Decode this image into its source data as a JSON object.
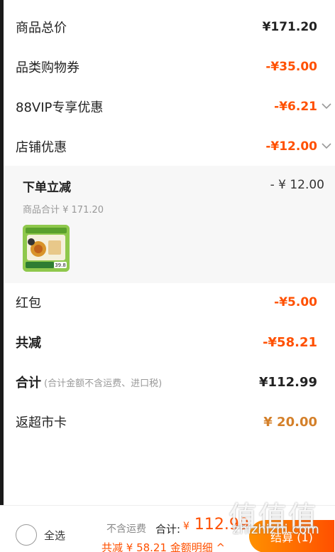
{
  "rows": {
    "goods_total": {
      "label": "商品总价",
      "value": "¥171.20"
    },
    "category_coupon": {
      "label": "品类购物券",
      "value": "-¥35.00"
    },
    "vip_discount": {
      "label": "88VIP专享优惠",
      "value": "-¥6.21"
    },
    "store_discount": {
      "label": "店铺优惠",
      "value": "-¥12.00"
    },
    "red_packet": {
      "label": "红包",
      "value": "-¥5.00"
    },
    "total_reduction": {
      "label": "共减",
      "value": "-¥58.21"
    },
    "sum": {
      "label": "合计",
      "note": "(合计金额不含运费、进口税)",
      "value": "¥112.99"
    },
    "rebate_card": {
      "label": "返超市卡",
      "value": "¥ 20.00"
    }
  },
  "store_detail": {
    "title": "下单立减",
    "amount": "- ¥ 12.00",
    "subtotal": "商品合计 ¥ 171.20",
    "thumb_badge": "39.8"
  },
  "bottom_bar": {
    "select_all": "全选",
    "fee_note": "不含运费",
    "total_label": "合计:",
    "total_currency": "¥",
    "total_amount": "112.99",
    "reduce_text": "共减 ¥ 58.21  金额明细 ^",
    "checkout_label": "结算 (1)"
  },
  "watermark": {
    "glyphs": "值值值",
    "domain": "zhizhizhi.com"
  },
  "colors": {
    "accent": "#ff5000",
    "gold": "#d4802a",
    "panel_bg": "#f7f7f7"
  }
}
